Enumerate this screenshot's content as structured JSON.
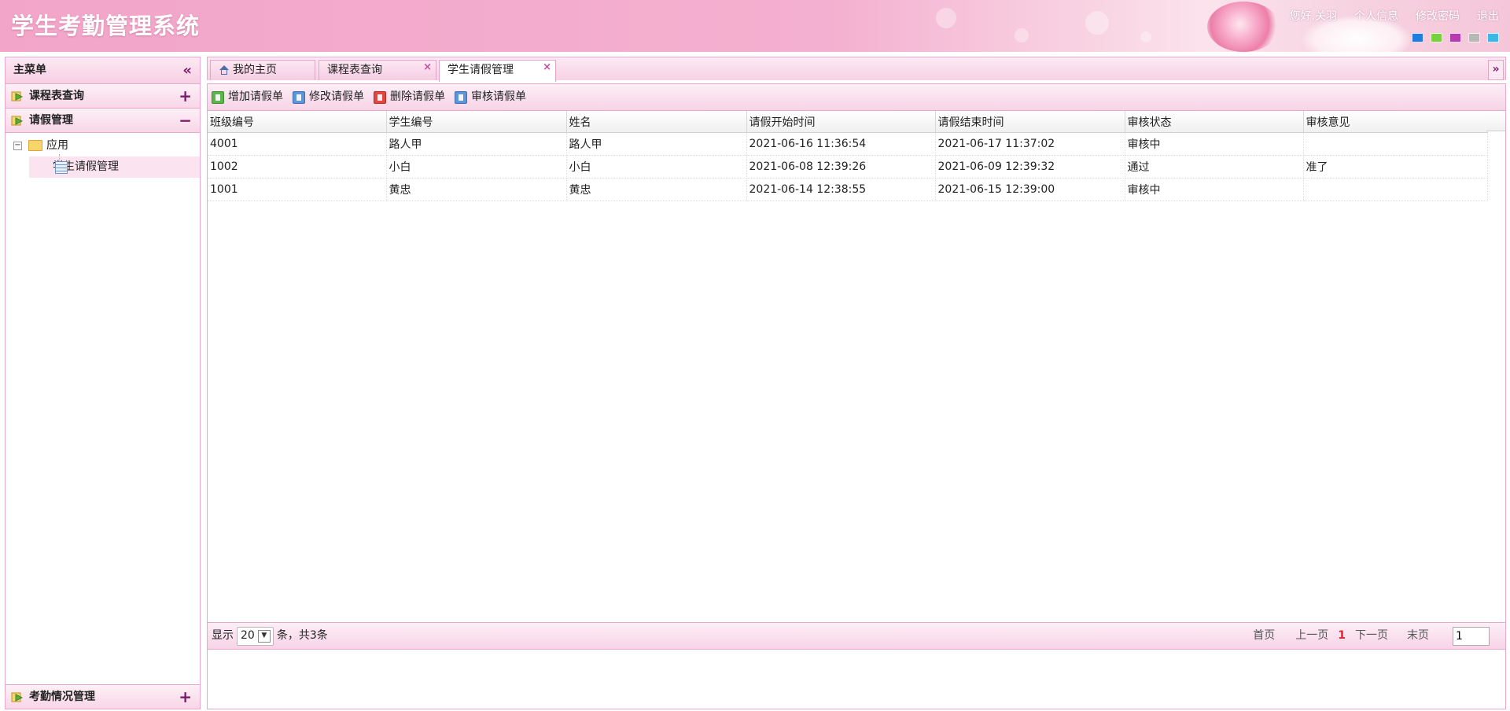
{
  "header": {
    "title": "学生考勤管理系统",
    "links": [
      "您好,关羽",
      "个人信息",
      "修改密码",
      "退出"
    ],
    "theme_colors": [
      "#1e7de0",
      "#7ad13f",
      "#b63ab0",
      "#b8b8b8",
      "#3cb8e8"
    ]
  },
  "sidebar": {
    "title": "主菜单",
    "collapse_icon": "double-chevron-left",
    "sections": [
      {
        "label": "课程表查询",
        "toggle": "+"
      },
      {
        "label": "请假管理",
        "toggle": "−"
      },
      {
        "label": "考勤情况管理",
        "toggle": "+"
      }
    ],
    "tree": {
      "root": "应用",
      "root_expander": "⊟",
      "leaf": "学生请假管理"
    }
  },
  "tabs": [
    {
      "label": "我的主页",
      "icon": "home-icon"
    },
    {
      "label": "课程表查询",
      "close": "×"
    },
    {
      "label": "学生请假管理",
      "close": "×"
    }
  ],
  "tabs_scroll": "»",
  "toolbar": {
    "add": "增加请假单",
    "edit": "修改请假单",
    "delete": "删除请假单",
    "audit": "审核请假单"
  },
  "grid": {
    "columns": [
      "班级编号",
      "学生编号",
      "姓名",
      "请假开始时间",
      "请假结束时间",
      "审核状态",
      "审核意见"
    ],
    "rows": [
      [
        "4001",
        "路人甲",
        "路人甲",
        "2021-06-16 11:36:54",
        "2021-06-17 11:37:02",
        "审核中",
        ""
      ],
      [
        "1002",
        "小白",
        "小白",
        "2021-06-08 12:39:26",
        "2021-06-09 12:39:32",
        "通过",
        "准了"
      ],
      [
        "1001",
        "黄忠",
        "黄忠",
        "2021-06-14 12:38:55",
        "2021-06-15 12:39:00",
        "审核中",
        ""
      ]
    ]
  },
  "pager": {
    "show_label": "显示",
    "page_size": "20",
    "total_text": "条，共3条",
    "first": "首页",
    "prev": "上一页",
    "current": "1",
    "next": "下一页",
    "last": "末页",
    "jump_value": "1"
  }
}
